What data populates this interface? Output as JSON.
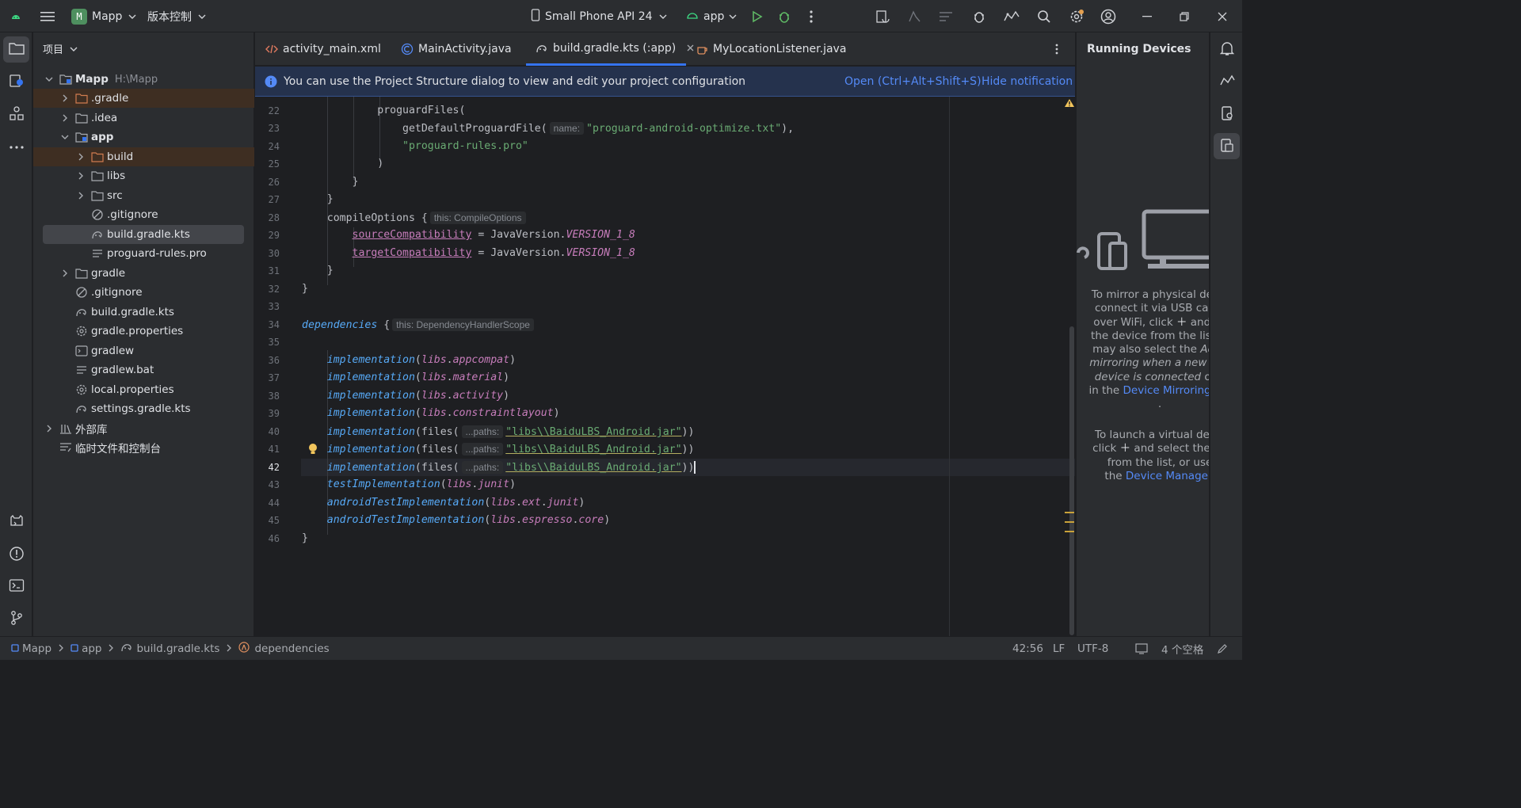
{
  "titlebar": {
    "project_badge": "M",
    "project_name": "Mapp",
    "vcs_label": "版本控制",
    "device": "Small Phone API 24",
    "run_config": "app"
  },
  "project_panel": {
    "title": "项目",
    "tree": [
      {
        "label": "Mapp",
        "sub": "H:\\Mapp"
      },
      {
        "label": ".gradle"
      },
      {
        "label": ".idea"
      },
      {
        "label": "app"
      },
      {
        "label": "build"
      },
      {
        "label": "libs"
      },
      {
        "label": "src"
      },
      {
        "label": ".gitignore"
      },
      {
        "label": "build.gradle.kts"
      },
      {
        "label": "proguard-rules.pro"
      },
      {
        "label": "gradle"
      },
      {
        "label": ".gitignore"
      },
      {
        "label": "build.gradle.kts"
      },
      {
        "label": "gradle.properties"
      },
      {
        "label": "gradlew"
      },
      {
        "label": "gradlew.bat"
      },
      {
        "label": "local.properties"
      },
      {
        "label": "settings.gradle.kts"
      },
      {
        "label": "外部库"
      },
      {
        "label": "临时文件和控制台"
      }
    ]
  },
  "tabs": [
    {
      "label": "activity_main.xml"
    },
    {
      "label": "MainActivity.java"
    },
    {
      "label": "build.gradle.kts (:app)"
    },
    {
      "label": "MyLocationListener.java"
    }
  ],
  "notification": {
    "message": "You can use the Project Structure dialog to view and edit your project configuration",
    "action_open": "Open (Ctrl+Alt+Shift+S)",
    "action_hide": "Hide notification"
  },
  "editor": {
    "line_numbers": [
      "22",
      "23",
      "24",
      "25",
      "26",
      "27",
      "28",
      "29",
      "30",
      "31",
      "32",
      "33",
      "34",
      "35",
      "36",
      "37",
      "38",
      "39",
      "40",
      "41",
      "42",
      "43",
      "44",
      "45",
      "46"
    ],
    "current_line": "42",
    "code": {
      "l22": "proguardFiles(",
      "l23a": "getDefaultProguardFile(",
      "l23h": "name:",
      "l23s": "\"proguard-android-optimize.txt\"",
      "l23e": "),",
      "l24": "\"proguard-rules.pro\"",
      "l25": ")",
      "l26": "}",
      "l27": "}",
      "l28a": "compileOptions {",
      "l28h": "this: CompileOptions",
      "l29p": "sourceCompatibility",
      "l29m": " = JavaVersion.",
      "l29c": "VERSION_1_8",
      "l30p": "targetCompatibility",
      "l30m": " = JavaVersion.",
      "l30c": "VERSION_1_8",
      "l31": "}",
      "l32": "}",
      "l34a": "dependencies",
      "l34b": " {",
      "l34h": "this: DependencyHandlerScope",
      "impl": "implementation",
      "libs": "libs",
      "l36m": "appcompat",
      "l37m": "material",
      "l38m": "activity",
      "l39m": "constraintlayout",
      "files": "files(",
      "paths": "...paths:",
      "jar": "\"libs\\\\BaiduLBS_Android.jar\"",
      "l43f": "testImplementation",
      "l43m": "junit",
      "l44f": "androidTestImplementation",
      "l44x": "ext",
      "l44m": "junit",
      "l45f": "androidTestImplementation",
      "l45x": "espresso",
      "l45m": "core",
      "l46": "}"
    }
  },
  "running_devices": {
    "title": "Running Devices",
    "p1": [
      "To mirror a physical devic",
      "connect it via USB cable",
      "over WiFi, click",
      "and se",
      "the device from the list. Y",
      "may also select the",
      "Activ",
      "mirroring when a new phy",
      "device is connected",
      "opti",
      "in the",
      "Device Mirroring set",
      "."
    ],
    "p2": [
      "To launch a virtual devic",
      "click",
      "and select the de",
      "from the list, or use",
      "the",
      "Device Manager",
      "."
    ]
  },
  "statusbar": {
    "breadcrumbs": [
      "Mapp",
      "app",
      "build.gradle.kts",
      "dependencies"
    ],
    "position": "42:56",
    "line_ending": "LF",
    "encoding": "UTF-8",
    "indent": "4 个空格"
  },
  "colors": {
    "accent": "#3574f0",
    "link": "#548af7",
    "string": "#6aab73",
    "keyword_fn": "#57aaf7",
    "property": "#c77dbb"
  }
}
